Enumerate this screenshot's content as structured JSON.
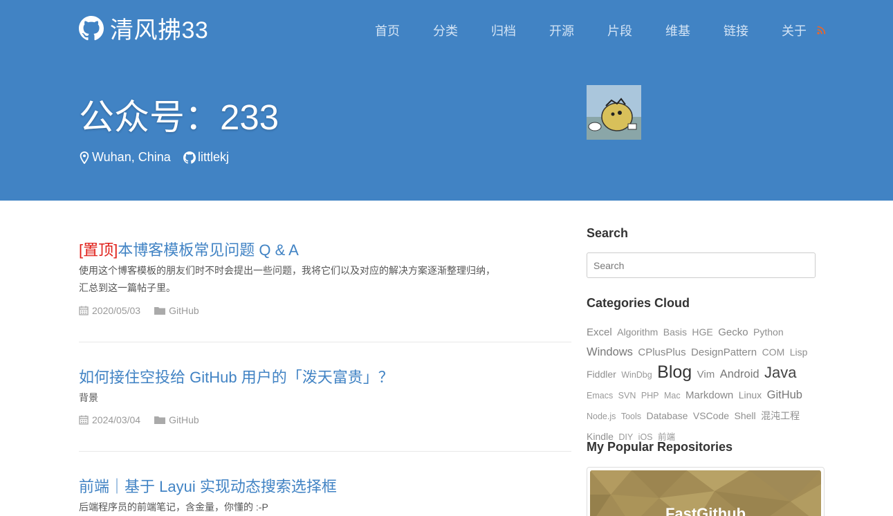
{
  "site": {
    "title": "清风拂33"
  },
  "nav": {
    "items": [
      "首页",
      "分类",
      "归档",
      "开源",
      "片段",
      "维基",
      "链接",
      "关于"
    ]
  },
  "hero": {
    "title": "公众号：233",
    "location": "Wuhan, China",
    "github": "littlekj"
  },
  "posts": [
    {
      "pin": "[置顶]",
      "title": "本博客模板常见问题 Q & A",
      "excerpt": "使用这个博客模板的朋友们时不时会提出一些问题，我将它们以及对应的解决方案逐渐整理归纳，汇总到这一篇帖子里。",
      "date": "2020/05/03",
      "category": "GitHub"
    },
    {
      "pin": "",
      "title": "如何接住空投给 GitHub 用户的「泼天富贵」？",
      "excerpt": "背景",
      "date": "2024/03/04",
      "category": "GitHub"
    },
    {
      "pin": "",
      "title": "前端｜基于 Layui 实现动态搜索选择框",
      "excerpt": "后端程序员的前端笔记，含金量，你懂的 :-P",
      "date": "",
      "category": ""
    }
  ],
  "sidebar": {
    "search_heading": "Search",
    "search_placeholder": "Search",
    "categories_heading": "Categories Cloud",
    "tags": [
      {
        "name": "Excel",
        "level": 2
      },
      {
        "name": "Algorithm",
        "level": 1
      },
      {
        "name": "Basis",
        "level": 1
      },
      {
        "name": "HGE",
        "level": 1
      },
      {
        "name": "Gecko",
        "level": 2
      },
      {
        "name": "Python",
        "level": 1
      },
      {
        "name": "Windows",
        "level": 3
      },
      {
        "name": "CPlusPlus",
        "level": 2
      },
      {
        "name": "DesignPattern",
        "level": 2
      },
      {
        "name": "COM",
        "level": 1
      },
      {
        "name": "Lisp",
        "level": 1
      },
      {
        "name": "Fiddler",
        "level": 1
      },
      {
        "name": "WinDbg",
        "level": 0
      },
      {
        "name": "Blog",
        "level": 6
      },
      {
        "name": "Vim",
        "level": 2
      },
      {
        "name": "Android",
        "level": 3
      },
      {
        "name": "Java",
        "level": 5
      },
      {
        "name": "Emacs",
        "level": 0
      },
      {
        "name": "SVN",
        "level": 0
      },
      {
        "name": "PHP",
        "level": 0
      },
      {
        "name": "Mac",
        "level": 0
      },
      {
        "name": "Markdown",
        "level": 2
      },
      {
        "name": "Linux",
        "level": 1
      },
      {
        "name": "GitHub",
        "level": 3
      },
      {
        "name": "Node.js",
        "level": 0
      },
      {
        "name": "Tools",
        "level": 0
      },
      {
        "name": "Database",
        "level": 1
      },
      {
        "name": "VSCode",
        "level": 1
      },
      {
        "name": "Shell",
        "level": 1
      },
      {
        "name": "混沌工程",
        "level": 1
      },
      {
        "name": "Kindle",
        "level": 1
      },
      {
        "name": "DIY",
        "level": 0
      },
      {
        "name": "iOS",
        "level": 0
      },
      {
        "name": "前端",
        "level": 0
      }
    ],
    "repos_heading": "My Popular Repositories",
    "repo_name": "FastGithub"
  },
  "colors": {
    "header_bg": "#4183c4",
    "link": "#4183c4",
    "pin": "#e0201a",
    "rss": "#f26522"
  },
  "icons": {
    "brand": "github-icon",
    "location": "location-pin-icon",
    "github": "github-icon",
    "date": "calendar-icon",
    "category": "folder-icon",
    "rss": "rss-icon"
  }
}
